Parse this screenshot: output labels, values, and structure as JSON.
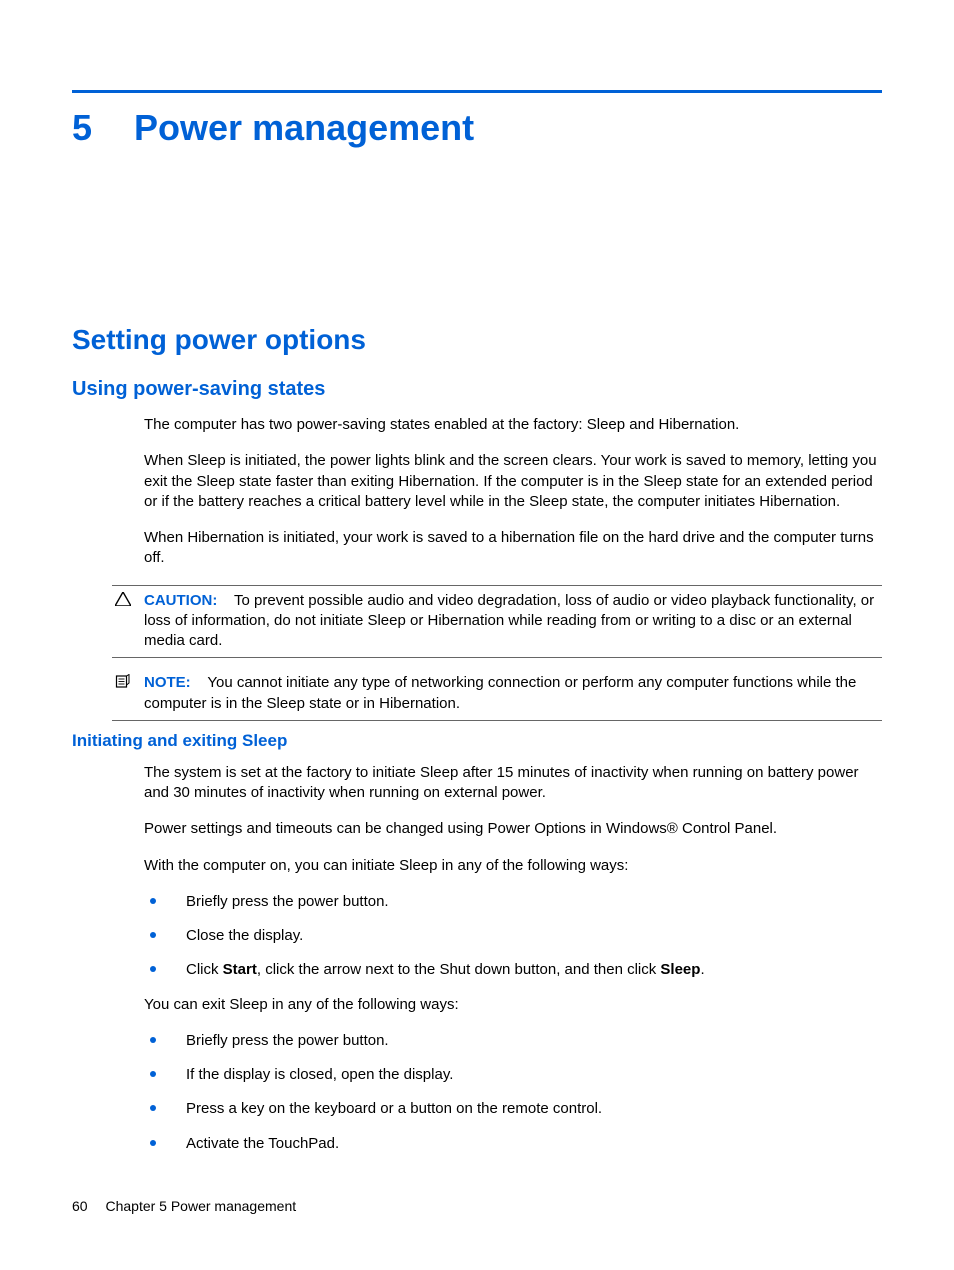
{
  "chapter": {
    "number": "5",
    "title": "Power management"
  },
  "section": {
    "title": "Setting power options"
  },
  "sub1": {
    "title": "Using power-saving states",
    "p1": "The computer has two power-saving states enabled at the factory: Sleep and Hibernation.",
    "p2": "When Sleep is initiated, the power lights blink and the screen clears. Your work is saved to memory, letting you exit the Sleep state faster than exiting Hibernation. If the computer is in the Sleep state for an extended period or if the battery reaches a critical battery level while in the Sleep state, the computer initiates Hibernation.",
    "p3": "When Hibernation is initiated, your work is saved to a hibernation file on the hard drive and the computer turns off."
  },
  "caution": {
    "label": "CAUTION:",
    "text": "To prevent possible audio and video degradation, loss of audio or video playback functionality, or loss of information, do not initiate Sleep or Hibernation while reading from or writing to a disc or an external media card."
  },
  "note": {
    "label": "NOTE:",
    "text": "You cannot initiate any type of networking connection or perform any computer functions while the computer is in the Sleep state or in Hibernation."
  },
  "sub2": {
    "title": "Initiating and exiting Sleep",
    "p1": "The system is set at the factory to initiate Sleep after 15 minutes of inactivity when running on battery power and 30 minutes of inactivity when running on external power.",
    "p2": "Power settings and timeouts can be changed using Power Options in Windows® Control Panel.",
    "p3": "With the computer on, you can initiate Sleep in any of the following ways:",
    "list1": {
      "i0": "Briefly press the power button.",
      "i1": "Close the display.",
      "i2_pre": "Click ",
      "i2_b1": "Start",
      "i2_mid": ", click the arrow next to the Shut down button, and then click ",
      "i2_b2": "Sleep",
      "i2_post": "."
    },
    "p4": "You can exit Sleep in any of the following ways:",
    "list2": {
      "i0": "Briefly press the power button.",
      "i1": "If the display is closed, open the display.",
      "i2": "Press a key on the keyboard or a button on the remote control.",
      "i3": "Activate the TouchPad."
    }
  },
  "footer": {
    "page": "60",
    "label": "Chapter 5   Power management"
  }
}
